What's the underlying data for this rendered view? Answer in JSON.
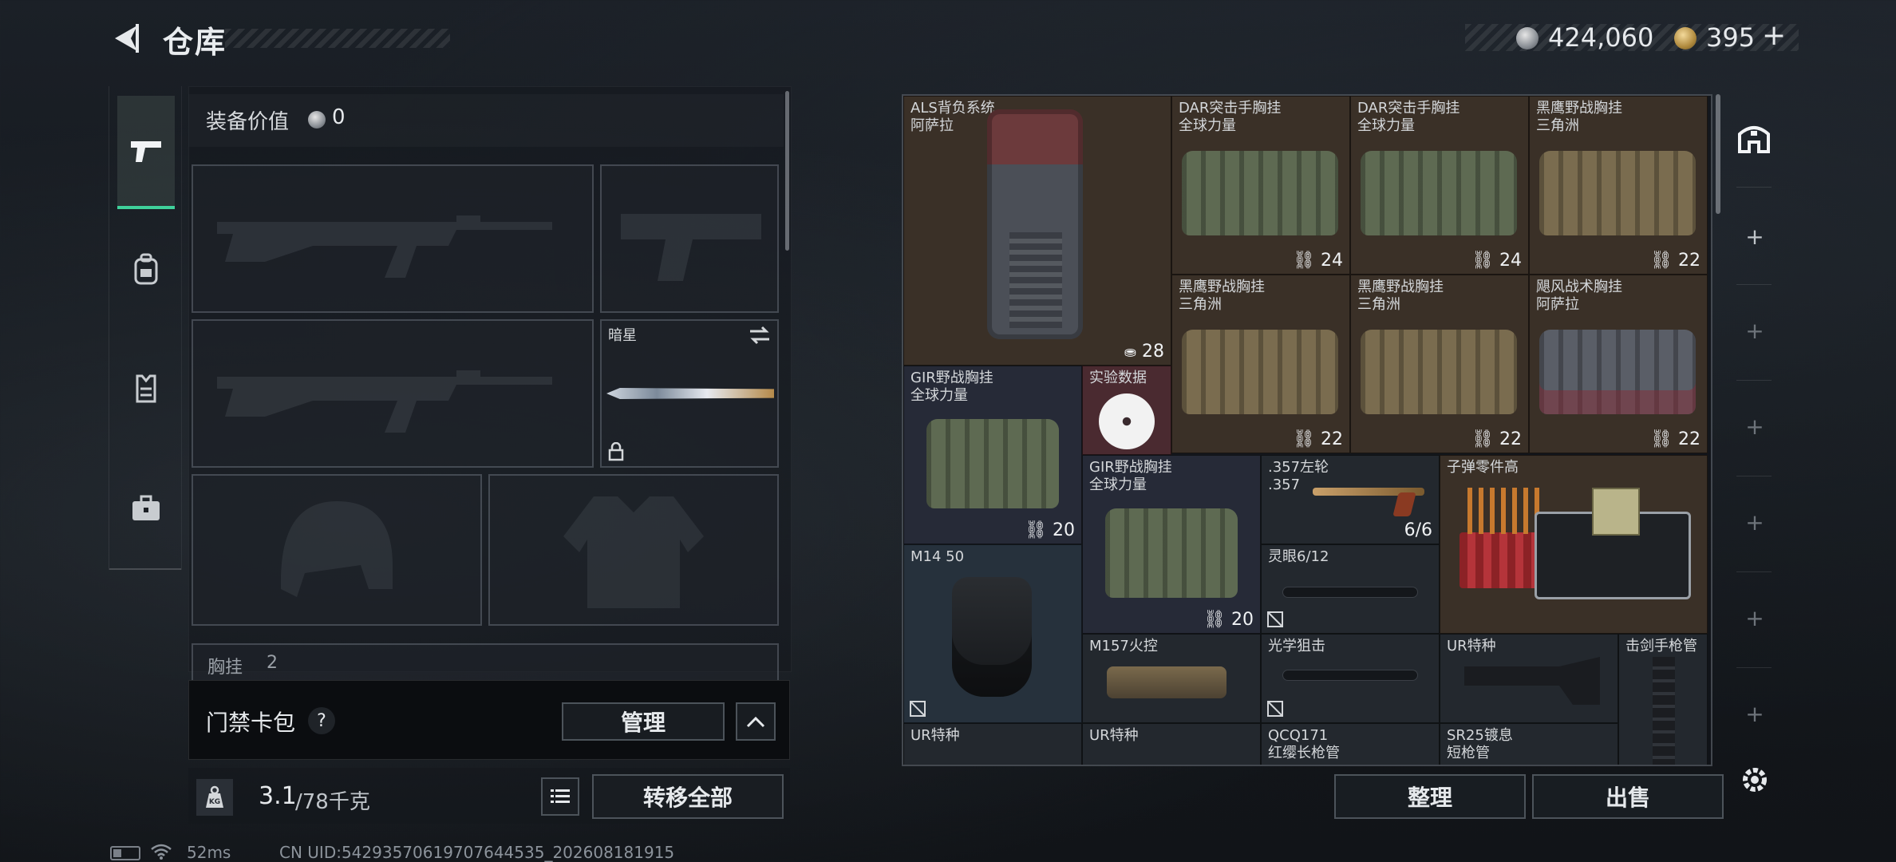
{
  "header": {
    "title": "仓库",
    "money": "424,060",
    "gold": "395",
    "gold_plus": "+"
  },
  "loadout": {
    "value_label": "装备价值",
    "value": "0",
    "slots": {
      "knife_label": "暗星",
      "chest_rig_label": "胸挂",
      "chest_rig_count": "2"
    }
  },
  "access_card": {
    "label": "门禁卡包",
    "help": "?",
    "manage_label": "管理"
  },
  "weight": {
    "current": "3.1",
    "capacity": "/78千克"
  },
  "actions": {
    "transfer_all": "转移全部",
    "sort": "整理",
    "sell": "出售"
  },
  "status_bar": {
    "ping": "52ms",
    "uid": "CN UID:54293570619707644535_202608181915"
  },
  "items": [
    {
      "name": "ALS背负系统",
      "sub": "阿萨拉",
      "count": "28"
    },
    {
      "name": "DAR突击手胸挂",
      "sub": "全球力量",
      "count": "24"
    },
    {
      "name": "DAR突击手胸挂",
      "sub": "全球力量",
      "count": "24"
    },
    {
      "name": "黑鹰野战胸挂",
      "sub": "三角洲",
      "count": "22"
    },
    {
      "name": "黑鹰野战胸挂",
      "sub": "三角洲",
      "count": "22"
    },
    {
      "name": "黑鹰野战胸挂",
      "sub": "三角洲",
      "count": "22"
    },
    {
      "name": "飓风战术胸挂",
      "sub": "阿萨拉",
      "count": "22"
    },
    {
      "name": "GIR野战胸挂",
      "sub": "全球力量",
      "count": "20"
    },
    {
      "name": "实验数据",
      "sub": "",
      "count": ""
    },
    {
      "name": "GIR野战胸挂",
      "sub": "全球力量",
      "count": "20"
    },
    {
      "name": ".357左轮",
      "sub": ".357",
      "count": "6/6"
    },
    {
      "name": "子弹零件高",
      "sub": "",
      "count": ""
    },
    {
      "name": "M14 50",
      "sub": "",
      "count": ""
    },
    {
      "name": "灵眼6/12",
      "sub": "",
      "count": ""
    },
    {
      "name": "M157火控",
      "sub": "",
      "count": ""
    },
    {
      "name": "光学狙击",
      "sub": "",
      "count": ""
    },
    {
      "name": "UR特种",
      "sub": "",
      "count": ""
    },
    {
      "name": "击剑手枪管",
      "sub": "",
      "count": ""
    },
    {
      "name": "UR特种",
      "sub": "",
      "count": ""
    },
    {
      "name": "UR特种",
      "sub": "",
      "count": ""
    },
    {
      "name": "QCQ171",
      "sub": "红缨长枪管",
      "count": ""
    },
    {
      "name": "SR25镀息",
      "sub": "短枪管",
      "count": ""
    }
  ],
  "icons": [
    "back-arrow-icon",
    "silver-coin-icon",
    "gold-coin-icon",
    "pistol-icon",
    "backpack-icon",
    "armor-vest-icon",
    "briefcase-icon",
    "swap-icon",
    "lock-icon",
    "help-icon",
    "chevron-up-icon",
    "weight-icon",
    "list-icon",
    "safehouse-icon",
    "plus-icon",
    "gear-icon",
    "battery-icon",
    "wifi-icon",
    "weight-badge-icon",
    "unlocked-icon"
  ]
}
